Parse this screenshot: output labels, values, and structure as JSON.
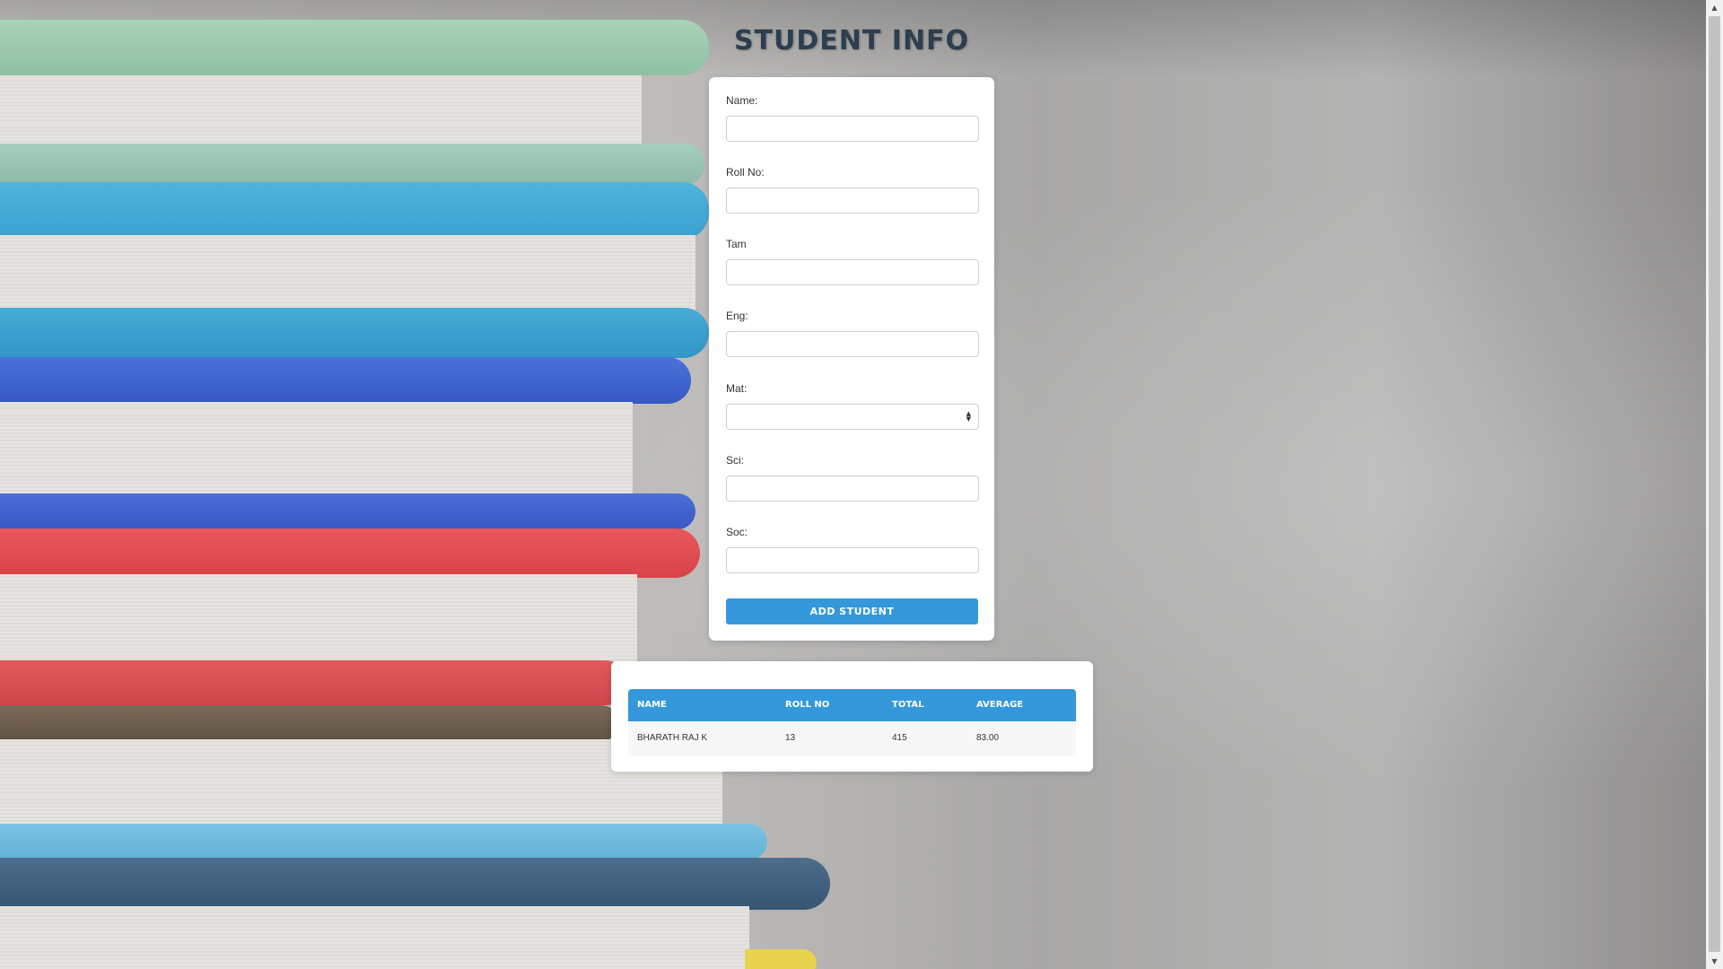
{
  "page": {
    "title": "STUDENT INFO"
  },
  "form": {
    "fields": [
      {
        "label": "Name:",
        "value": ""
      },
      {
        "label": "Roll No:",
        "value": ""
      },
      {
        "label": "Tam",
        "value": ""
      },
      {
        "label": "Eng:",
        "value": ""
      },
      {
        "label": "Mat:",
        "value": ""
      },
      {
        "label": "Sci:",
        "value": ""
      },
      {
        "label": "Soc:",
        "value": ""
      }
    ],
    "submit_label": "ADD STUDENT"
  },
  "table": {
    "headers": [
      "NAME",
      "ROLL NO",
      "TOTAL",
      "AVERAGE"
    ],
    "rows": [
      [
        "BHARATH RAJ K",
        "13",
        "415",
        "83.00"
      ]
    ]
  },
  "scrollbar": {
    "up_arrow": "▲",
    "down_arrow": "▼"
  },
  "colors": {
    "accent": "#3498db",
    "title": "#2c3e50"
  }
}
